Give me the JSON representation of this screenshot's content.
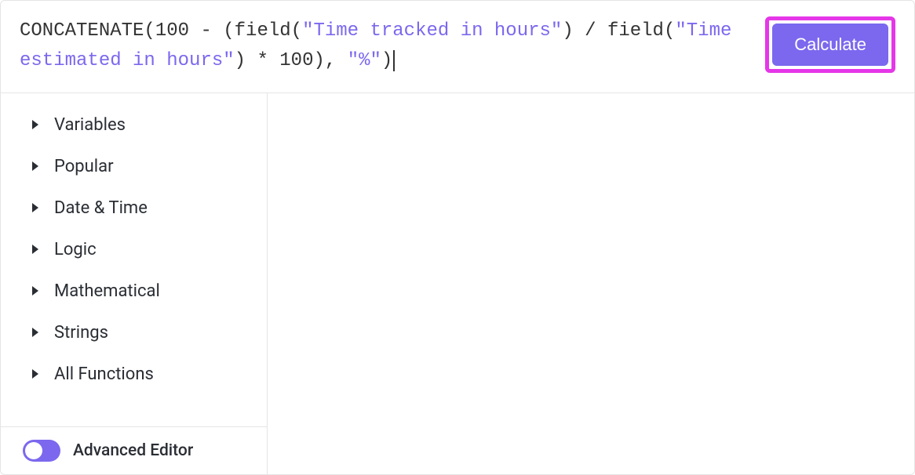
{
  "formula": {
    "parts": [
      {
        "type": "fn",
        "text": "CONCATENATE(100 - (field("
      },
      {
        "type": "str",
        "text": "\"Time tracked in hours\""
      },
      {
        "type": "fn",
        "text": ") / field("
      },
      {
        "type": "str",
        "text": "\"Time estimated in hours\""
      },
      {
        "type": "fn",
        "text": ") * 100), "
      },
      {
        "type": "str",
        "text": "\"%\""
      },
      {
        "type": "fn",
        "text": ")"
      }
    ]
  },
  "calculate_label": "Calculate",
  "sidebar": {
    "categories": [
      {
        "label": "Variables"
      },
      {
        "label": "Popular"
      },
      {
        "label": "Date & Time"
      },
      {
        "label": "Logic"
      },
      {
        "label": "Mathematical"
      },
      {
        "label": "Strings"
      },
      {
        "label": "All Functions"
      }
    ]
  },
  "footer": {
    "advanced_editor_label": "Advanced Editor",
    "advanced_editor_on": true
  }
}
